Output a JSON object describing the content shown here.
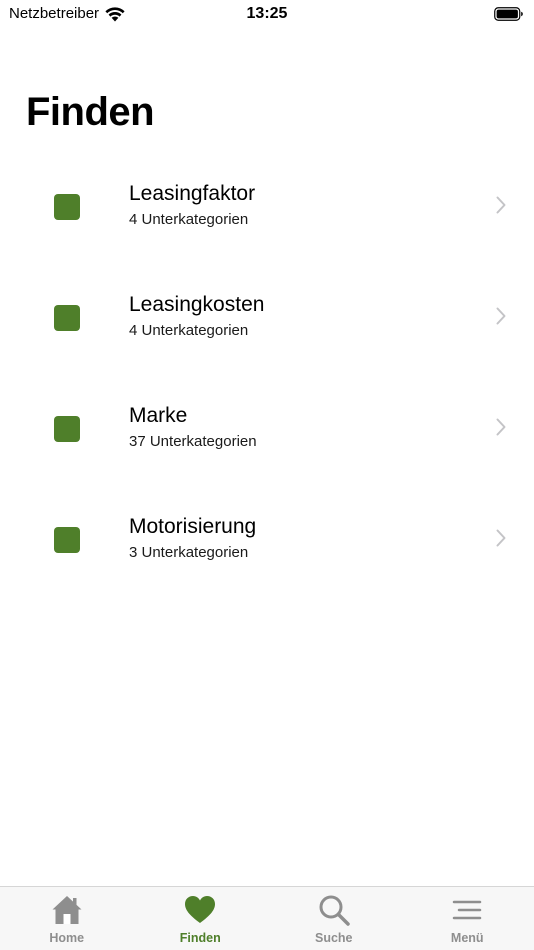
{
  "status_bar": {
    "carrier": "Netzbetreiber",
    "time": "13:25"
  },
  "page": {
    "title": "Finden"
  },
  "categories": [
    {
      "label": "Leasingfaktor",
      "subtitle": "4 Unterkategorien"
    },
    {
      "label": "Leasingkosten",
      "subtitle": "4 Unterkategorien"
    },
    {
      "label": "Marke",
      "subtitle": "37 Unterkategorien"
    },
    {
      "label": "Motorisierung",
      "subtitle": "3 Unterkategorien"
    }
  ],
  "tab_bar": {
    "tabs": [
      {
        "label": "Home",
        "icon": "home-icon",
        "active": false
      },
      {
        "label": "Finden",
        "icon": "heart-icon",
        "active": true
      },
      {
        "label": "Suche",
        "icon": "search-icon",
        "active": false
      },
      {
        "label": "Menü",
        "icon": "menu-icon",
        "active": false
      }
    ]
  },
  "colors": {
    "accent": "#4f7f2a",
    "inactive": "#8e8e8e",
    "chevron": "#c4c4c7"
  }
}
